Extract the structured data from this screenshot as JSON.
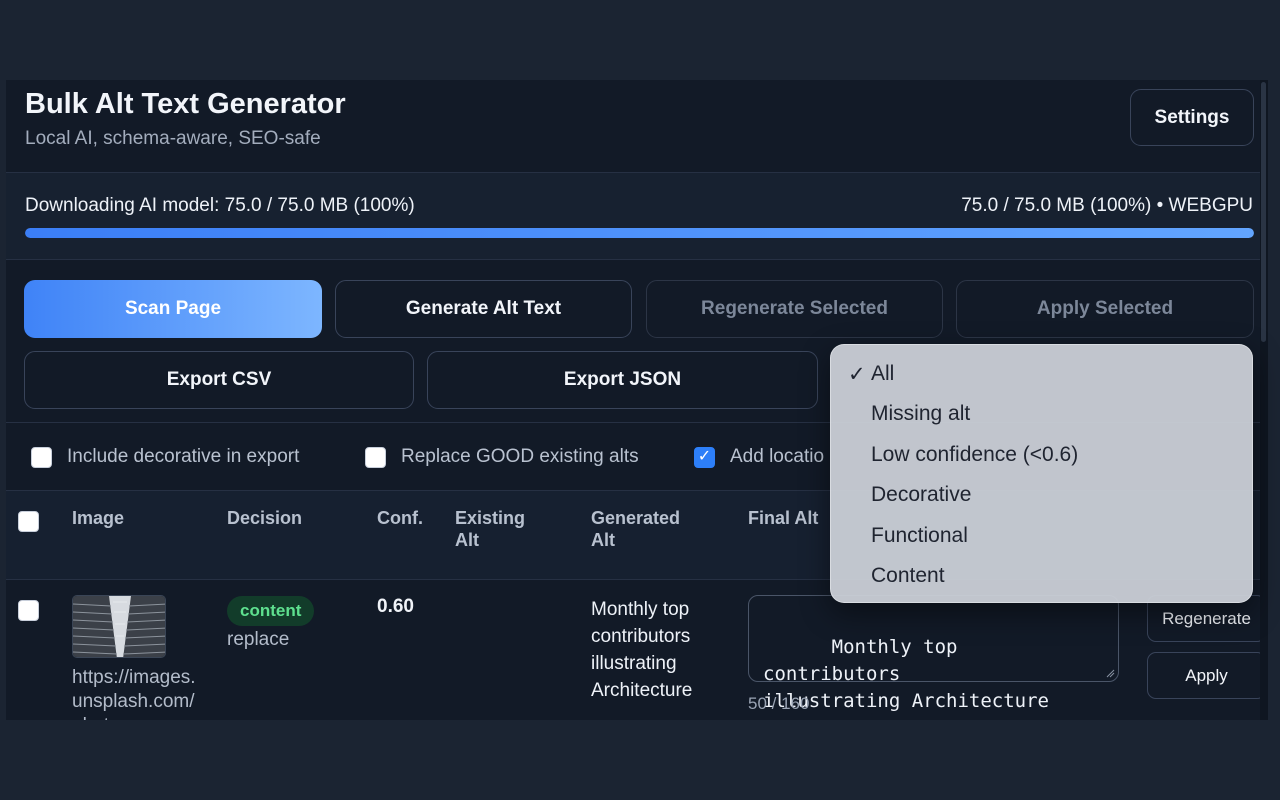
{
  "header": {
    "title": "Bulk Alt Text Generator",
    "subtitle": "Local AI, schema-aware, SEO-safe",
    "settings_label": "Settings"
  },
  "progress": {
    "status_text": "Downloading AI model: 75.0 / 75.0 MB (100%)",
    "detail_text": "75.0 / 75.0 MB (100%) • WEBGPU",
    "percent": 100,
    "fill_color": "#4a8ff8"
  },
  "toolbar": {
    "scan_label": "Scan Page",
    "generate_label": "Generate Alt Text",
    "regenerate_selected_label": "Regenerate Selected",
    "apply_selected_label": "Apply Selected",
    "export_csv_label": "Export CSV",
    "export_json_label": "Export JSON"
  },
  "options": {
    "include_decorative": {
      "label": "Include decorative in export",
      "checked": false
    },
    "replace_good": {
      "label": "Replace GOOD existing alts",
      "checked": false
    },
    "add_location": {
      "label": "Add locatio",
      "checked": true
    }
  },
  "filter_dropdown": {
    "selected": "All",
    "options": [
      "All",
      "Missing alt",
      "Low confidence (<0.6)",
      "Decorative",
      "Functional",
      "Content"
    ]
  },
  "table": {
    "headers": {
      "image": "Image",
      "decision": "Decision",
      "confidence": "Conf.",
      "existing_alt": "Existing Alt",
      "generated_alt": "Generated Alt",
      "final_alt": "Final Alt"
    },
    "rows": [
      {
        "url": "https://images.unsplash.com/phot",
        "decision_badge": "content",
        "decision_action": "replace",
        "confidence": "0.60",
        "existing_alt": "",
        "generated_alt": "Monthly top contributors illustrating Architecture",
        "final_alt": "Monthly top contributors\nillustrating Architecture",
        "char_count": "50 / 160",
        "regenerate_label": "Regenerate",
        "apply_label": "Apply"
      }
    ]
  },
  "colors": {
    "accent": "#3f83f7",
    "badge_bg": "#123c2a",
    "badge_text": "#5ee08f",
    "app_bg": "#121a27"
  }
}
